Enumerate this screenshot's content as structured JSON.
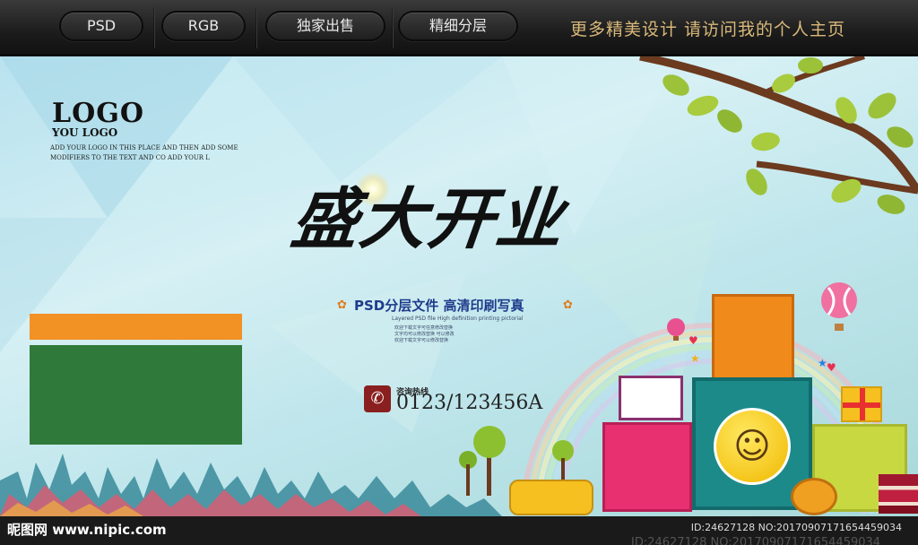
{
  "topbar": {
    "pills": [
      {
        "label": "PSD"
      },
      {
        "label": "RGB"
      },
      {
        "label": "独家出售"
      },
      {
        "label": "精细分层"
      }
    ],
    "tagline": "更多精美设计  请访问我的个人主页"
  },
  "banner": {
    "logo": {
      "title": "LOGO",
      "subtitle": "YOU LOGO",
      "desc": "ADD YOUR LOGO IN THIS PLACE AND THEN ADD SOME MODIFIERS TO THE TEXT AND CO ADD YOUR L"
    },
    "headline": "盛大开业",
    "subtitle": "PSD分层文件 高清印刷写真",
    "subtitle_en": "Layered PSD file High definition printing pictorial",
    "small_lines": [
      "欢迎下载文字可任意修改替换",
      "文字均可以修改替换 可以修改",
      "欢迎下载文字可以修改替换"
    ],
    "hotline_label": "咨询热线",
    "phone": "0123/123456A"
  },
  "watermark": {
    "site": "昵图网 www.nipic.com",
    "id": "ID:24627128 NO:20170907171654459034",
    "ghost": "ID:24627128 NO:20170907171654459034"
  },
  "colors": {
    "orange": "#f29124",
    "green": "#2f7a3a",
    "navy": "#1e3c8c",
    "tagline_gold": "#d9b97a"
  }
}
